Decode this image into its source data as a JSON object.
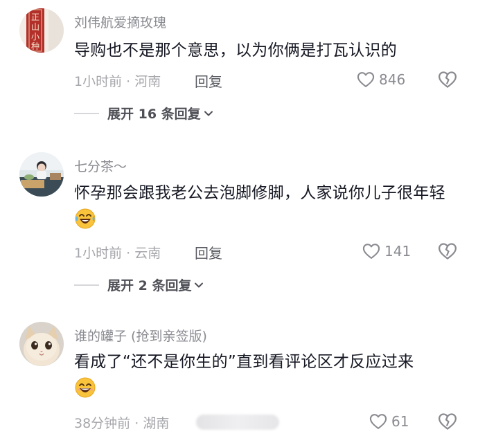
{
  "comments": [
    {
      "username": "刘伟航爱摘玫瑰",
      "text": "导购也不是那个意思，以为你俩是打瓦认识的",
      "time": "1小时前",
      "separator": "·",
      "location": "河南",
      "reply_label": "回复",
      "likes": "846",
      "replies_label": "展开 16 条回复",
      "avatar_text": [
        "正",
        "山",
        "小",
        "种"
      ]
    },
    {
      "username": "七分茶～",
      "text": "怀孕那会跟我老公去泡脚修脚，人家说你儿子很年轻",
      "time": "1小时前",
      "separator": "·",
      "location": "云南",
      "reply_label": "回复",
      "likes": "141",
      "replies_label": "展开 2 条回复"
    },
    {
      "username": "谁的罐子 (抢到亲签版)",
      "text": "看成了“还不是你生的”直到看评论区才反应过来",
      "time": "38分钟前",
      "separator": "·",
      "location": "湖南",
      "likes": "61"
    }
  ],
  "icons": {
    "like": "heart-outline-icon",
    "dislike": "broken-heart-icon",
    "expand": "chevron-down-icon",
    "emoji_1": "laughing-crying-emoji",
    "emoji_2": "grinning-emoji"
  },
  "colors": {
    "text_primary": "#161823",
    "text_secondary": "#8a8b91",
    "text_meta": "#a5a6ab",
    "avatar_red": "#b32f2a"
  }
}
